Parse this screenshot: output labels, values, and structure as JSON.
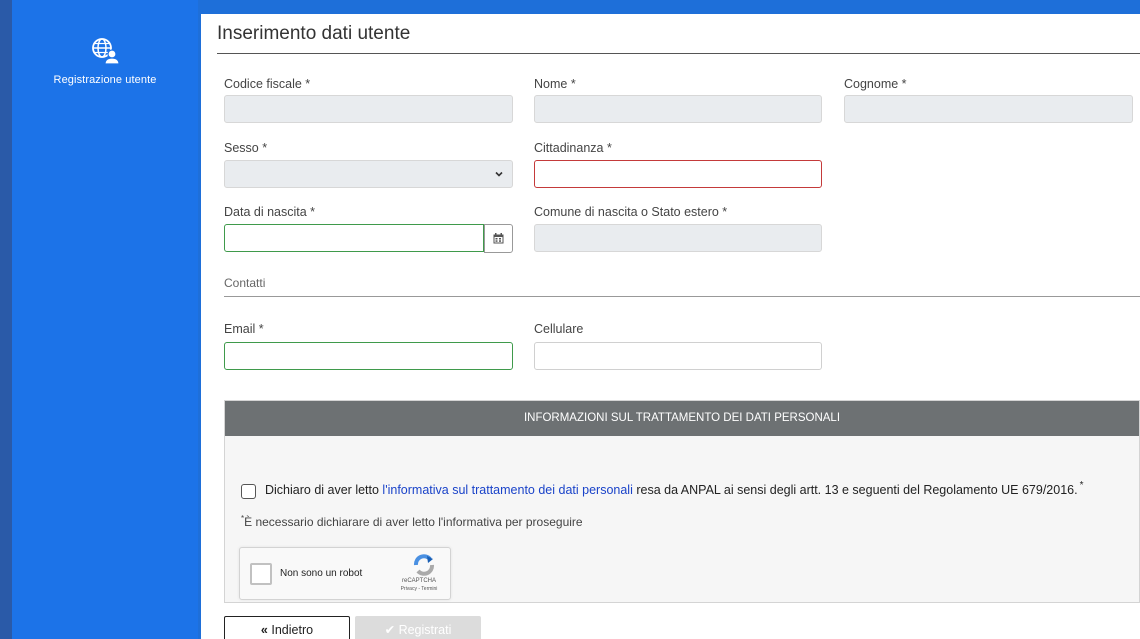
{
  "sidebar": {
    "item": {
      "label": "Registrazione utente",
      "icon": "globe-user-icon"
    }
  },
  "page": {
    "title": "Inserimento dati utente"
  },
  "form": {
    "codice_fiscale": {
      "label": "Codice fiscale *",
      "value": ""
    },
    "nome": {
      "label": "Nome *",
      "value": ""
    },
    "cognome": {
      "label": "Cognome *",
      "value": ""
    },
    "sesso": {
      "label": "Sesso *",
      "value": ""
    },
    "cittadinanza": {
      "label": "Cittadinanza *",
      "value": ""
    },
    "data_nascita": {
      "label": "Data di nascita *",
      "value": ""
    },
    "comune_nascita": {
      "label": "Comune di nascita o Stato estero *",
      "value": ""
    }
  },
  "contatti": {
    "section_label": "Contatti",
    "email": {
      "label": "Email *",
      "value": ""
    },
    "cellulare": {
      "label": "Cellulare",
      "value": ""
    }
  },
  "privacy": {
    "header": "INFORMAZIONI SUL TRATTAMENTO DEI DATI PERSONALI",
    "consent_prefix": "Dichiaro di aver letto ",
    "consent_link": "l'informativa sul trattamento dei dati personali",
    "consent_suffix": " resa da ANPAL ai sensi degli artt. 13 e seguenti del Regolamento UE 679/2016.",
    "consent_star": "*",
    "note_star": "*",
    "note": "È necessario dichiarare di aver letto l'informativa per proseguire",
    "recaptcha": {
      "label": "Non sono un robot",
      "brand": "reCAPTCHA",
      "terms": "Privacy - Termini"
    }
  },
  "buttons": {
    "back": {
      "icon": "«",
      "label": "Indietro"
    },
    "register": {
      "icon": "✔",
      "label": "Registrati"
    }
  },
  "colors": {
    "sidebar": "#1c73e8",
    "error_border": "#c43a3a",
    "valid_border": "#3f9a4b",
    "privacy_header": "#6d7173",
    "link": "#1a43c9"
  }
}
